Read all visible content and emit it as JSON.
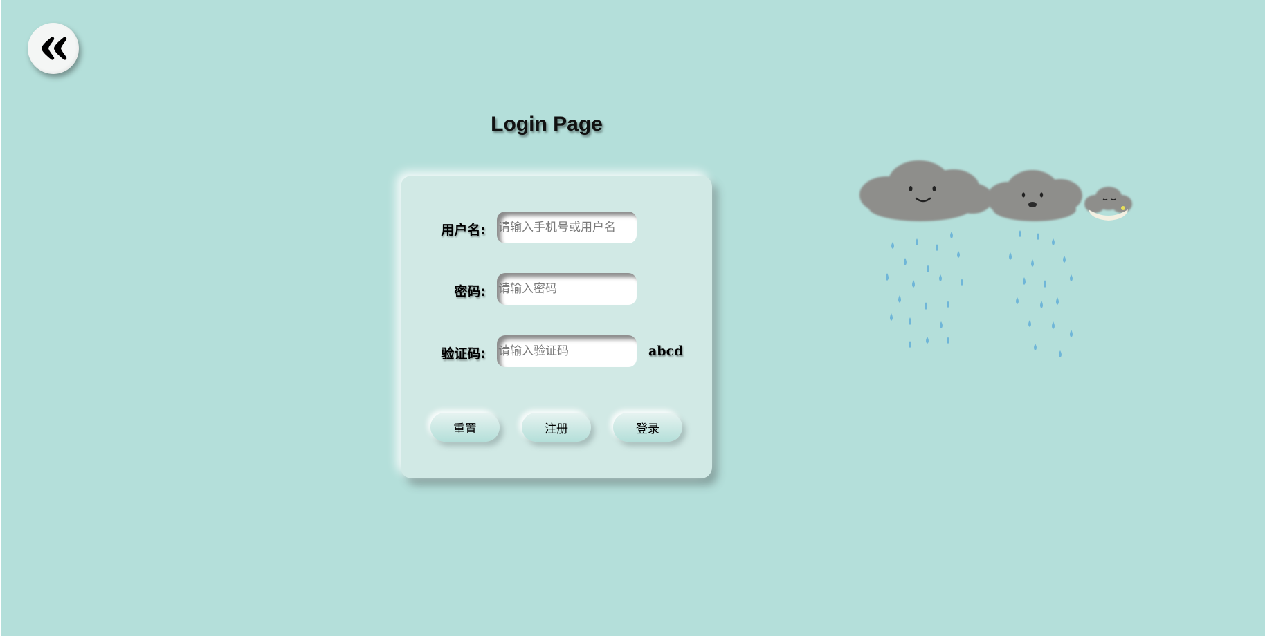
{
  "header": {
    "back_icon": "double-chevron-left-icon",
    "title": "Login Page"
  },
  "form": {
    "username": {
      "label": "用户名:",
      "placeholder": "请输入手机号或用户名",
      "value": ""
    },
    "password": {
      "label": "密码:",
      "placeholder": "请输入密码",
      "value": ""
    },
    "captcha": {
      "label": "验证码:",
      "placeholder": "请输入验证码",
      "value": "",
      "code": "abcd"
    },
    "buttons": {
      "reset": "重置",
      "register": "注册",
      "login": "登录"
    }
  },
  "decoration": {
    "illustration": "rain-clouds-illustration"
  },
  "colors": {
    "background": "#b4dfda",
    "card": "#d1e9e5",
    "cloud": "#8c8c8a",
    "raindrop": "#6fb6d8"
  }
}
